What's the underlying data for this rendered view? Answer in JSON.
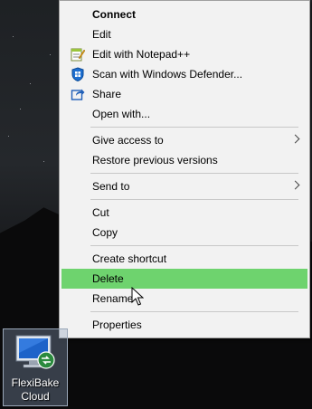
{
  "context_menu": {
    "items": [
      {
        "label": "Connect",
        "icon": "",
        "submenu": false,
        "bold": true
      },
      {
        "label": "Edit",
        "icon": "",
        "submenu": false
      },
      {
        "label": "Edit with Notepad++",
        "icon": "notepad-plus-plus-icon",
        "submenu": false
      },
      {
        "label": "Scan with Windows Defender...",
        "icon": "windows-defender-icon",
        "submenu": false
      },
      {
        "label": "Share",
        "icon": "share-icon",
        "submenu": false
      },
      {
        "label": "Open with...",
        "icon": "",
        "submenu": false
      },
      {
        "label": "Give access to",
        "icon": "",
        "submenu": true
      },
      {
        "label": "Restore previous versions",
        "icon": "",
        "submenu": false
      },
      {
        "label": "Send to",
        "icon": "",
        "submenu": true
      },
      {
        "label": "Cut",
        "icon": "",
        "submenu": false
      },
      {
        "label": "Copy",
        "icon": "",
        "submenu": false
      },
      {
        "label": "Create shortcut",
        "icon": "",
        "submenu": false
      },
      {
        "label": "Delete",
        "icon": "",
        "submenu": false,
        "highlighted": true
      },
      {
        "label": "Rename",
        "icon": "",
        "submenu": false
      },
      {
        "label": "Properties",
        "icon": "",
        "submenu": false
      }
    ],
    "highlight_color": "#6ed36e"
  },
  "desktop_icon": {
    "label_line1": "FlexiBake",
    "label_line2": "Cloud",
    "icon": "remote-desktop-icon"
  },
  "cursor": {
    "icon": "mouse-pointer-icon"
  }
}
